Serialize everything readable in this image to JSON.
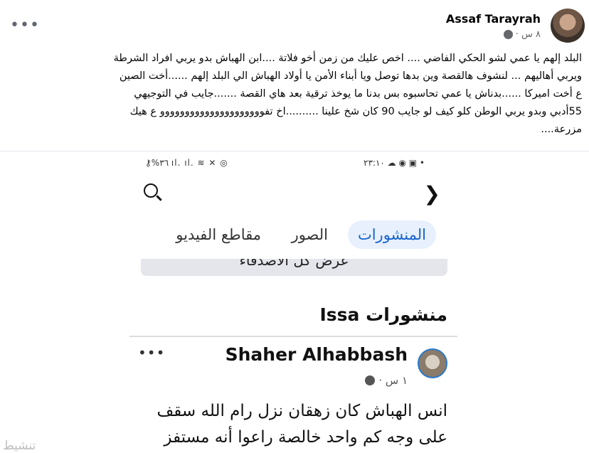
{
  "post": {
    "author": "Assaf Tarayrah",
    "time": "٨ س ·",
    "more_label": "•••",
    "text_lines": [
      "البلد إلهم يا عمي لشو الحكي الفاضي .... اخص عليك من زمن أخو فلاتة ....ابن الهباش بدو يربي افراد الشرطة",
      "ويربي أهاليهم ... لنشوف هالقصة وين بدها توصل ويا أبناء الأمن يا أولاد الهباش الي البلد إلهم ......أخت الصين",
      "ع أخت اميركا ......بدناش يا عمي تحاسبوه بس بدنا ما يوخذ ترقية بعد هاي القصة .......جايب في التوجيهي",
      "55أدبي وبدو يربي الوطن كلو كيف لو جايب 90 كان شخ علينا ..........اخ تفووووووووووووووووووووو ع هيك",
      "مزرعة...."
    ]
  },
  "screenshot": {
    "status_left": "⚷%٣٦ ıl. ıl. ≋ ✕ ◎",
    "status_right": "٢٣:١٠ ☁ ◉ ▣ •",
    "back_chevron": "❯",
    "tabs": [
      {
        "label": "المنشورات",
        "active": true
      },
      {
        "label": "الصور",
        "active": false
      },
      {
        "label": "مقاطع الفيديو",
        "active": false
      }
    ],
    "partial_button": "عرض كل الأصدقاء",
    "section_title": "منشورات Issa",
    "inner_post": {
      "author": "Shaher Alhabbash",
      "time": "١ س ·",
      "more_label": "•••",
      "text_lines": [
        "انس الهباش كان زهقان نزل رام الله سقف",
        "على وجه كم واحد خالصة راعوا أنه مستفز"
      ]
    }
  },
  "watermark": "تنشيط",
  "icons": [
    "more-icon",
    "globe-icon",
    "search-icon",
    "chevron-right-icon",
    "avatar"
  ]
}
